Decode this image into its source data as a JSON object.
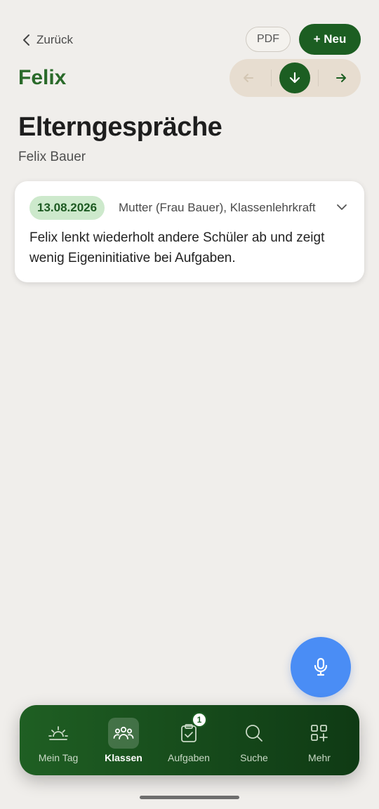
{
  "header": {
    "back_label": "Zurück",
    "pdf_label": "PDF",
    "new_label": "+ Neu",
    "student_name": "Felix"
  },
  "page": {
    "title": "Elterngespräche",
    "subtitle": "Felix Bauer"
  },
  "entries": [
    {
      "date": "13.08.2026",
      "participants": "Mutter (Frau Bauer), Klassenlehrkraft",
      "text": "Felix lenkt wiederholt andere Schüler ab und zeigt wenig Eigeninitiative bei Aufgaben."
    }
  ],
  "bottom_nav": {
    "items": [
      {
        "label": "Mein Tag",
        "icon": "sunrise-icon"
      },
      {
        "label": "Klassen",
        "icon": "group-icon",
        "active": true
      },
      {
        "label": "Aufgaben",
        "icon": "clipboard-check-icon",
        "badge": "1"
      },
      {
        "label": "Suche",
        "icon": "search-icon"
      },
      {
        "label": "Mehr",
        "icon": "grid-plus-icon"
      }
    ]
  },
  "colors": {
    "background": "#f0eeeb",
    "primary_green": "#1c5e22",
    "mic_blue": "#4a8df5",
    "badge_green_bg": "#cde9cc"
  }
}
